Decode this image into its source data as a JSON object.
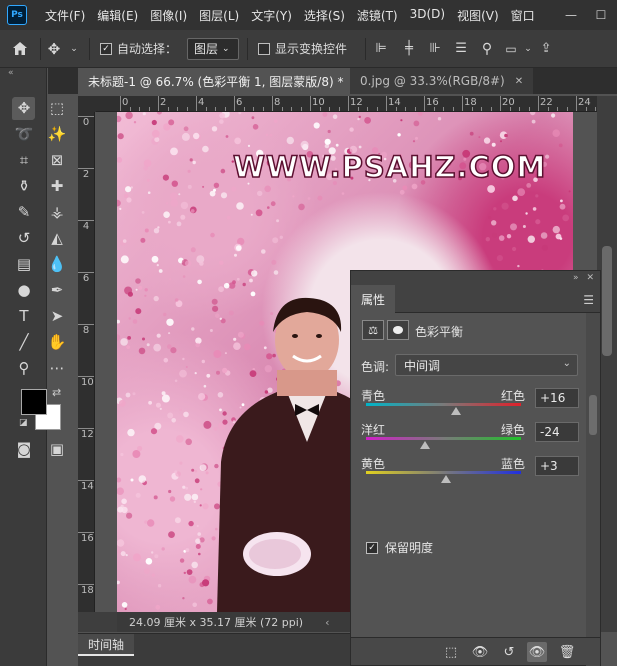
{
  "app": {
    "logo": "Ps"
  },
  "menu": [
    "文件(F)",
    "编辑(E)",
    "图像(I)",
    "图层(L)",
    "文字(Y)",
    "选择(S)",
    "滤镜(T)",
    "3D(D)",
    "视图(V)",
    "窗口"
  ],
  "window_controls": {
    "minimize": "—",
    "maximize": "☐"
  },
  "options": {
    "auto_select_label": "自动选择：",
    "auto_select_checked": true,
    "target_value": "图层",
    "show_transform_label": "显示变换控件",
    "show_transform_checked": false
  },
  "tabs": [
    {
      "label": "未标题-1 @ 66.7% (色彩平衡 1, 图层蒙版/8) *",
      "close": "✕"
    },
    {
      "label": "0.jpg @ 33.3%(RGB/8#)",
      "close": "✕"
    }
  ],
  "ruler_top": [
    "0",
    "2",
    "4",
    "6",
    "8",
    "10",
    "12",
    "14",
    "16",
    "18",
    "20",
    "22",
    "24"
  ],
  "ruler_left": [
    "0",
    "2",
    "4",
    "6",
    "8",
    "10",
    "12",
    "14",
    "16",
    "18"
  ],
  "canvas": {
    "watermark": "WWW.PSAHZ.COM"
  },
  "status": {
    "doc_size": "24.09 厘米 x 35.17 厘米 (72 ppi)",
    "arrow": "‹"
  },
  "timeline": {
    "tab": "时间轴"
  },
  "properties": {
    "tab": "属性",
    "title": "色彩平衡",
    "tone_label": "色调:",
    "tone_value": "中间调",
    "sliders": [
      {
        "left": "青色",
        "right": "红色",
        "value": "+16",
        "level": 16
      },
      {
        "left": "洋红",
        "right": "绿色",
        "value": "-24",
        "level": -24
      },
      {
        "left": "黄色",
        "right": "蓝色",
        "value": "+3",
        "level": 3
      }
    ],
    "preserve_label": "保留明度",
    "preserve_checked": true
  },
  "colors": {
    "foreground": "#000000",
    "background": "#ffffff",
    "accent": "#31a8ff"
  }
}
